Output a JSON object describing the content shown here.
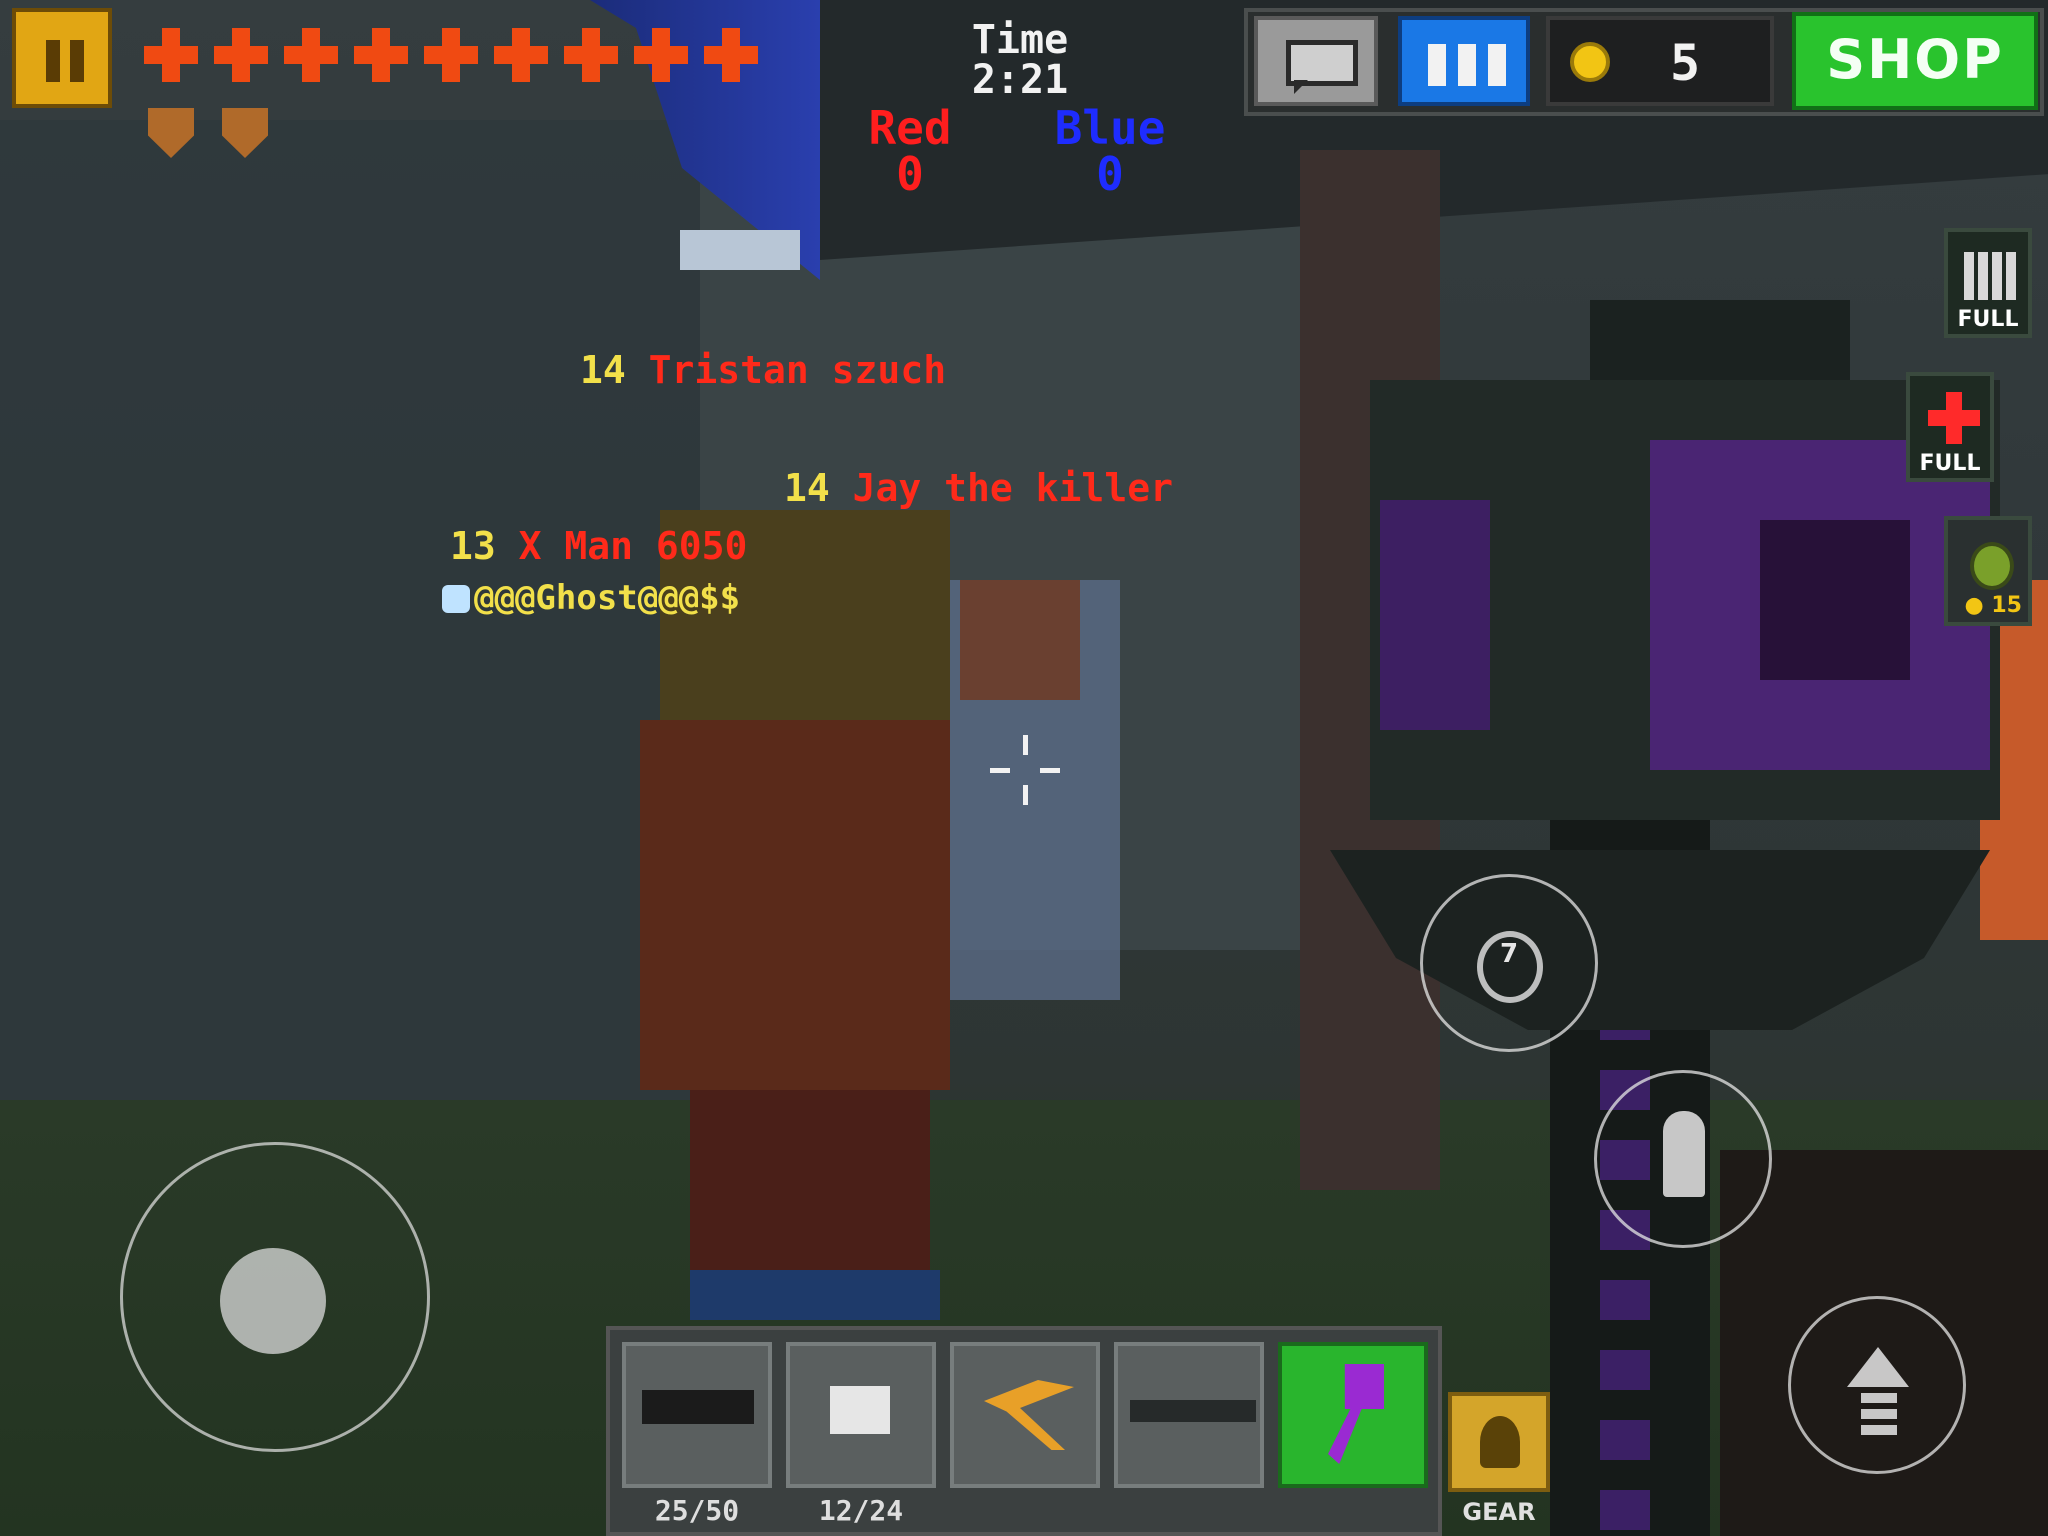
{
  "hud": {
    "health_count": 9,
    "armor_count": 2,
    "timer": {
      "label": "Time",
      "value": "2:21"
    },
    "score": {
      "red": {
        "label": "Red",
        "value": "0",
        "color": "#ff1e1e"
      },
      "blue": {
        "label": "Blue",
        "value": "0",
        "color": "#1e2cff"
      }
    },
    "coins": "5",
    "shop_label": "SHOP",
    "icons": [
      "pause-icon",
      "chat-icon",
      "team-icon",
      "coin-icon",
      "ammo-icon",
      "medkit-icon",
      "grenade-icon",
      "bullet-icon",
      "jump-arrow-icon",
      "gear-icon"
    ]
  },
  "side_items": {
    "ammo": {
      "label": "FULL"
    },
    "medkit": {
      "label": "FULL"
    },
    "grenade": {
      "price": "15"
    }
  },
  "players": [
    {
      "level": "14",
      "name": "Tristan szuch"
    },
    {
      "level": "14",
      "name": "Jay the killer"
    },
    {
      "level": "13",
      "name": "X Man 6050"
    },
    {
      "level": "",
      "name": "@@@Ghost@@@$$"
    }
  ],
  "controls": {
    "grenade_count": "7"
  },
  "weapons": [
    {
      "name": "assault-rifle",
      "ammo": "25/50"
    },
    {
      "name": "pistol",
      "ammo": "12/24"
    },
    {
      "name": "pickaxe",
      "ammo": ""
    },
    {
      "name": "sniper-rifle",
      "ammo": ""
    },
    {
      "name": "magic-staff",
      "ammo": "",
      "active": true
    }
  ],
  "gear_label": "GEAR",
  "colors": {
    "shop": "#29c32d",
    "team_button": "#1a78e6",
    "pause": "#e1a614",
    "health": "#f04a12"
  }
}
